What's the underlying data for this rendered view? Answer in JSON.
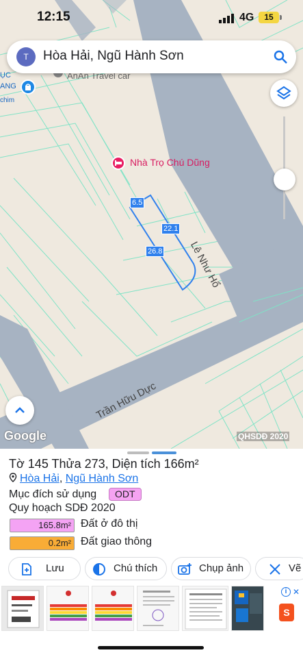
{
  "status_bar": {
    "time": "12:15",
    "network": "4G",
    "battery": "15"
  },
  "search": {
    "avatar_letter": "T",
    "query": "Hòa Hải, Ngũ Hành Sơn"
  },
  "map": {
    "poi_partial": "AnAn Travel car",
    "edge_labels": [
      "ỤC",
      "ANG",
      "chim"
    ],
    "place_label": "Nhà Trọ Chú Dũng",
    "dimensions": [
      "6.5",
      "22.1",
      "26.8"
    ],
    "roads": [
      "Lê Như Hổ",
      "Trần Hữu Dực"
    ],
    "attribution": "Google",
    "overlay_tag": "QHSDĐ 2020"
  },
  "info": {
    "title": "Tờ 145 Thửa 273, Diện tích 166m²",
    "location": {
      "ward": "Hòa Hải",
      "separator": ", ",
      "district": "Ngũ Hành Sơn"
    },
    "purpose_label": "Mục đích sử dụng",
    "purpose_code": "ODT",
    "plan_label": "Quy hoạch SDĐ 2020",
    "areas": [
      {
        "value": "165.8m²",
        "label": "Đất ở đô thị",
        "color": "#f4a3f4"
      },
      {
        "value": "0.2m²",
        "label": "Đất giao thông",
        "color": "#f9ac36"
      }
    ]
  },
  "actions": [
    {
      "label": "Lưu",
      "icon": "bookmark-add-icon"
    },
    {
      "label": "Chú thích",
      "icon": "contrast-icon"
    },
    {
      "label": "Chụp ảnh",
      "icon": "camera-icon"
    },
    {
      "label": "Vẽ",
      "icon": "draw-icon"
    }
  ],
  "colors": {
    "accent": "#1a73e8",
    "parcel_outline": "#2f80ed",
    "road": "#a7b3c2",
    "grid": "#7fe3c6"
  }
}
